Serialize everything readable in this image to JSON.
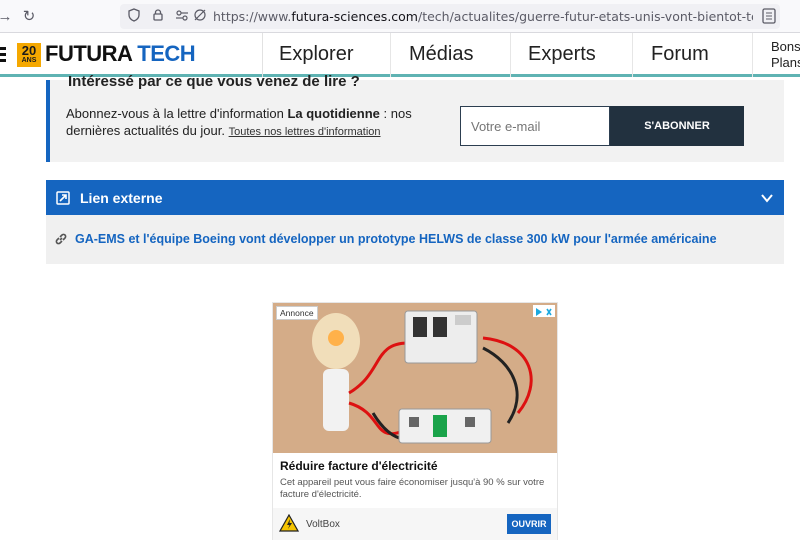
{
  "browser": {
    "url_protocol": "https://www.",
    "url_domain": "futura-sciences.com",
    "url_path": "/tech/actualites/guerre-futur-etats-unis-vont-bientot-tester-plus-puiss"
  },
  "header": {
    "logo_badge_number": "20",
    "logo_badge_text": "ANS",
    "logo_text_main": "FUTURA",
    "logo_text_accent": "TECH",
    "nav": [
      "Explorer",
      "Médias",
      "Experts",
      "Forum"
    ],
    "nav_last_line1": "Bons",
    "nav_last_line2": "Plans",
    "accent_color": "#1565c0",
    "header_rule_color": "#5fb3b3"
  },
  "newsletter": {
    "heading": "Intéressé par ce que vous venez de lire ?",
    "text_before": "Abonnez-vous à la lettre d'information ",
    "text_bold": "La quotidienne",
    "text_after": " : nos dernières actualités du jour. ",
    "link_label": "Toutes nos lettres d'information",
    "email_placeholder": "Votre e-mail",
    "subscribe_label": "S'ABONNER"
  },
  "external_link": {
    "section_title": "Lien externe",
    "link_text": "GA-EMS et l'équipe Boeing vont développer un prototype HELWS de classe 300 kW pour l'armée américaine"
  },
  "ad": {
    "badge": "Annonce",
    "title": "Réduire facture d'électricité",
    "description": "Cet appareil peut vous faire économiser jusqu'à 90 % sur votre facture d'électricité.",
    "brand": "VoltBox",
    "cta": "OUVRIR"
  }
}
